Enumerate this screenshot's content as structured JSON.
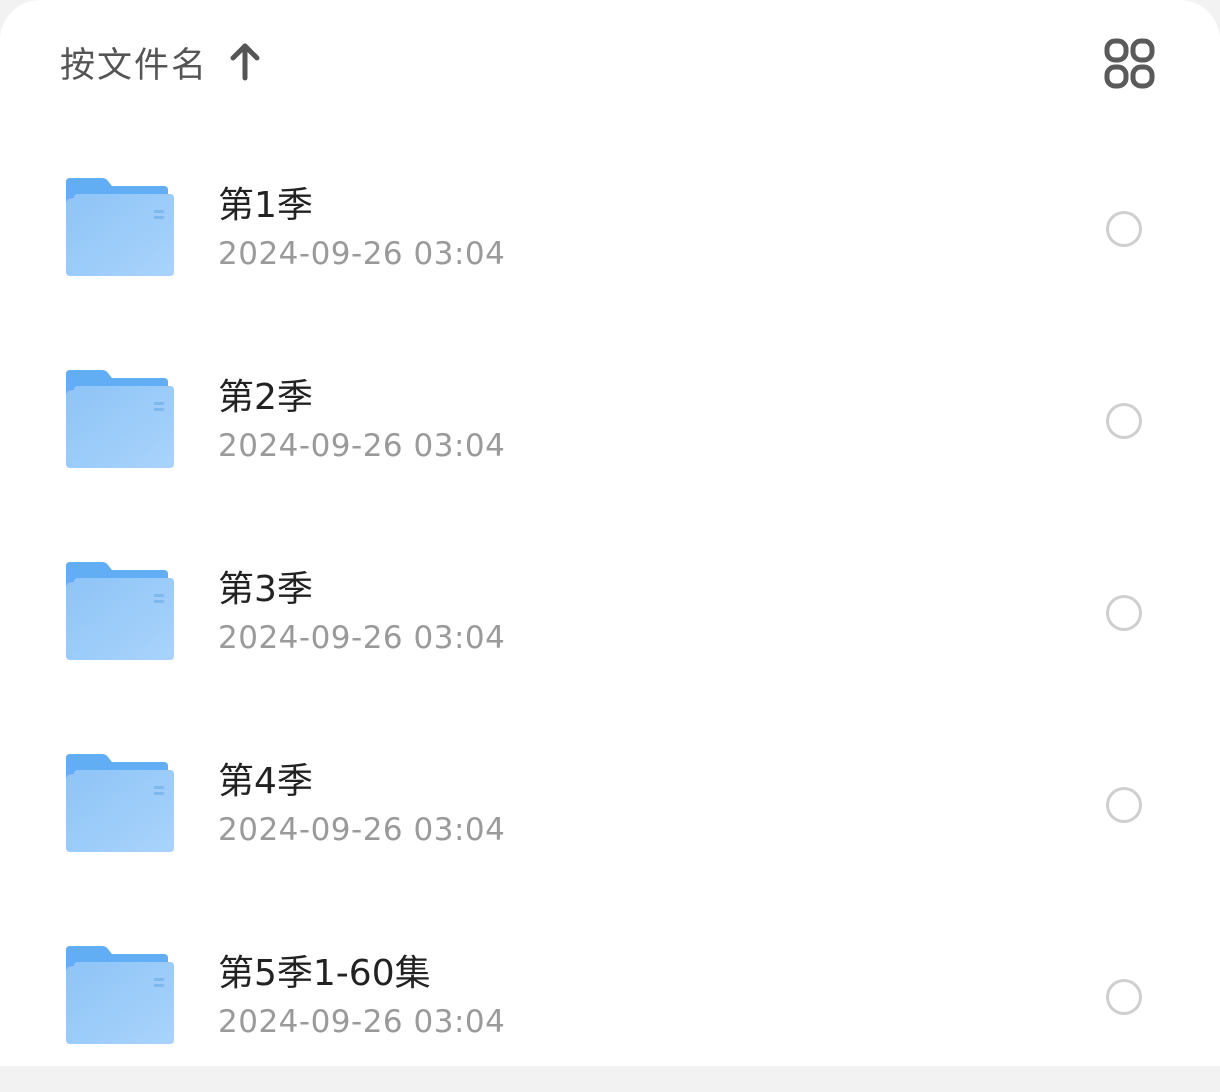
{
  "toolbar": {
    "sort_label": "按文件名",
    "sort_direction_icon": "arrow-up-icon",
    "view_toggle_icon": "grid-view-icon"
  },
  "files": [
    {
      "name": "第1季",
      "date": "2024-09-26 03:04",
      "icon": "folder-icon"
    },
    {
      "name": "第2季",
      "date": "2024-09-26 03:04",
      "icon": "folder-icon"
    },
    {
      "name": "第3季",
      "date": "2024-09-26 03:04",
      "icon": "folder-icon"
    },
    {
      "name": "第4季",
      "date": "2024-09-26 03:04",
      "icon": "folder-icon"
    },
    {
      "name": "第5季1-60集",
      "date": "2024-09-26 03:04",
      "icon": "folder-icon"
    }
  ],
  "colors": {
    "folder_front": "#a9d3fb",
    "folder_back": "#62aef4",
    "text_primary": "#222222",
    "text_secondary": "#9a9a9a",
    "circle_border": "#cfcfcf"
  }
}
